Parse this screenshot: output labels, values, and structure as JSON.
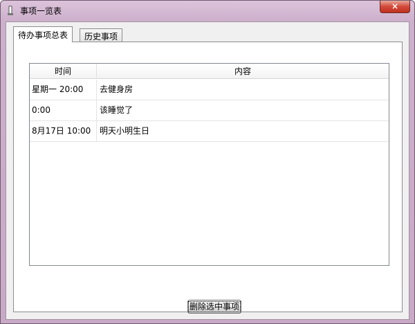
{
  "window": {
    "title": "事项一览表",
    "close_glyph": "×"
  },
  "tabs": [
    {
      "label": "待办事项总表",
      "active": true
    },
    {
      "label": "历史事项",
      "active": false
    }
  ],
  "table": {
    "columns": [
      "时间",
      "内容"
    ],
    "rows": [
      [
        "星期一 20:00",
        "去健身房"
      ],
      [
        "0:00",
        "该睡觉了"
      ],
      [
        "8月17日 10:00",
        "明天小明生日"
      ]
    ]
  },
  "actions": {
    "delete_label": "删除选中事项"
  },
  "icons": {
    "app": "app-icon",
    "close": "close-icon"
  },
  "colors": {
    "title_bar": "#cdb0cc",
    "close_button": "#d2493a",
    "panel": "#f0f0f0"
  }
}
